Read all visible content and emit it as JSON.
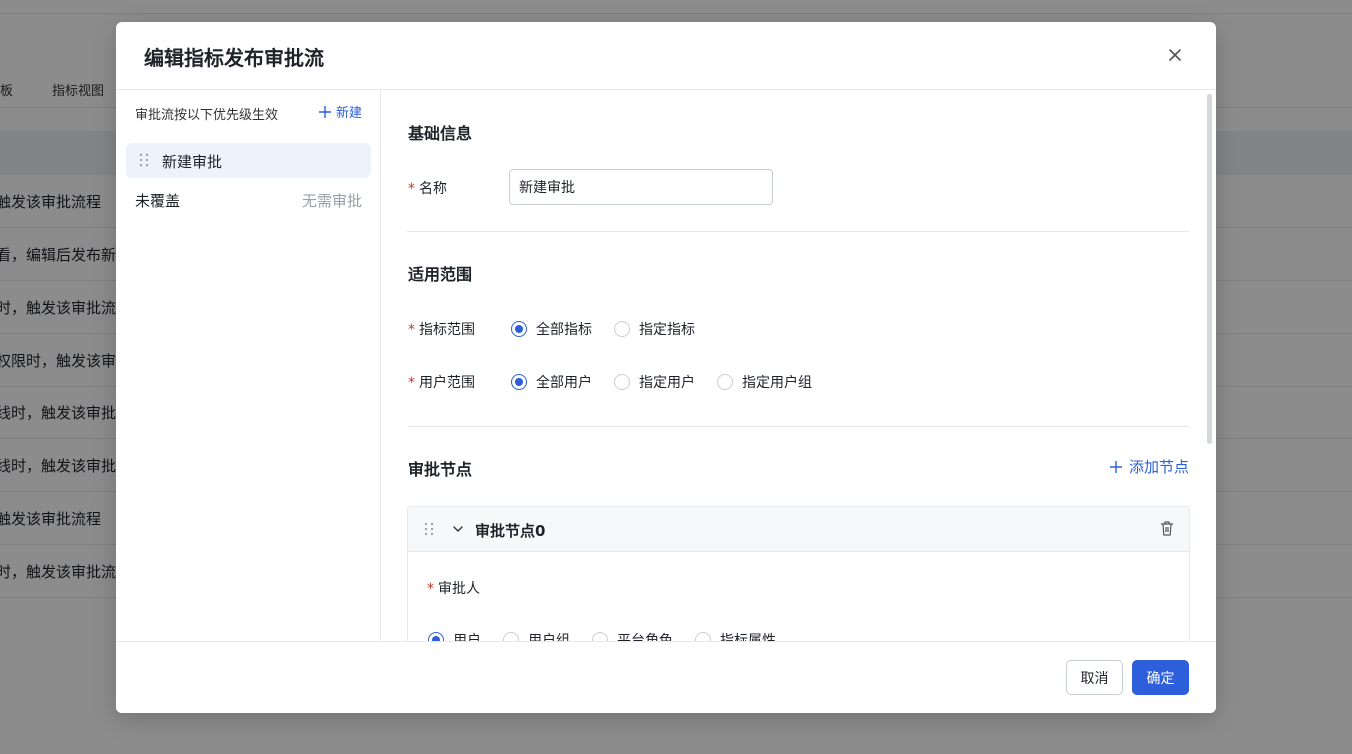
{
  "background": {
    "tabs": [
      "板",
      "指标视图"
    ],
    "rows": [
      "触发该审批流程",
      "看，编辑后发布新版",
      "时，触发该审批流程",
      "权限时，触发该审批",
      "线时，触发该审批流",
      "线时，触发该审批流",
      "触发该审批流程",
      "时，触发该审批流程"
    ]
  },
  "modal": {
    "title": "编辑指标发布审批流",
    "close_icon": "close-icon",
    "left": {
      "hint": "审批流按以下优先级生效",
      "new_label": "新建",
      "active_item": "新建审批",
      "uncovered_label": "未覆盖",
      "uncovered_status": "无需审批"
    },
    "basic": {
      "title": "基础信息",
      "name_label": "名称",
      "name_value": "新建审批"
    },
    "scope": {
      "title": "适用范围",
      "metric_label": "指标范围",
      "metric_options": [
        "全部指标",
        "指定指标"
      ],
      "metric_selected": "全部指标",
      "user_label": "用户范围",
      "user_options": [
        "全部用户",
        "指定用户",
        "指定用户组"
      ],
      "user_selected": "全部用户"
    },
    "nodes": {
      "title": "审批节点",
      "add_label": "添加节点",
      "node_title": "审批节点0",
      "approver_label": "审批人",
      "approver_options": [
        "用户",
        "用户组",
        "平台角色",
        "指标属性"
      ],
      "approver_selected": "用户"
    },
    "footer": {
      "cancel_label": "取消",
      "ok_label": "确定"
    },
    "colors": {
      "accent": "#2c5fd9",
      "required": "#c0392b"
    }
  }
}
